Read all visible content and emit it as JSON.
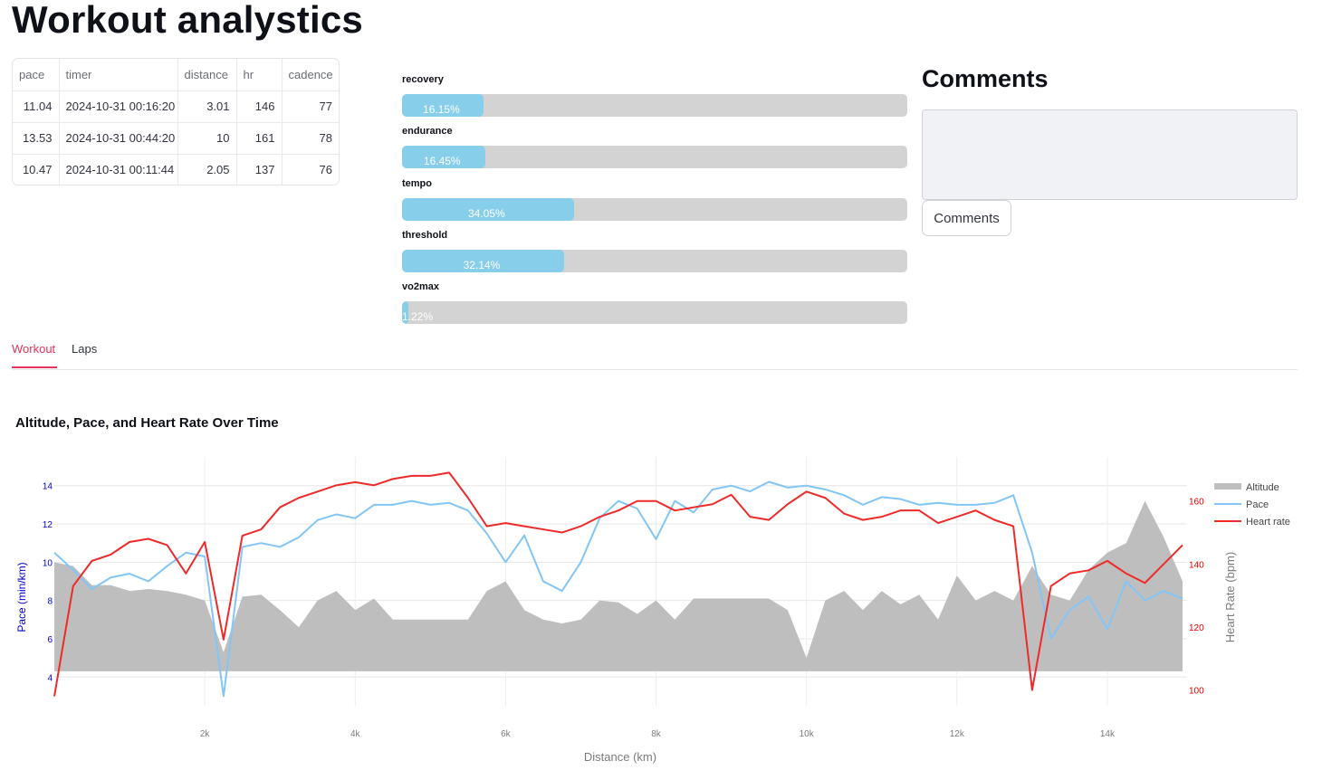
{
  "page": {
    "title": "Workout analystics"
  },
  "summary_table": {
    "columns": [
      "pace",
      "timer",
      "distance",
      "hr",
      "cadence"
    ],
    "rows": [
      [
        "11.04",
        "2024-10-31 00:16:20",
        "3.01",
        "146",
        "77"
      ],
      [
        "13.53",
        "2024-10-31 00:44:20",
        "10",
        "161",
        "78"
      ],
      [
        "10.47",
        "2024-10-31 00:11:44",
        "2.05",
        "137",
        "76"
      ]
    ]
  },
  "zones": [
    {
      "name": "recovery",
      "pct_label": "16.15%",
      "value": 16.15
    },
    {
      "name": "endurance",
      "pct_label": "16.45%",
      "value": 16.45
    },
    {
      "name": "tempo",
      "pct_label": "34.05%",
      "value": 34.05
    },
    {
      "name": "threshold",
      "pct_label": "32.14%",
      "value": 32.14
    },
    {
      "name": "vo2max",
      "pct_label": "1.22%",
      "value": 1.22
    }
  ],
  "comments": {
    "heading": "Comments",
    "textarea_value": "",
    "button_label": "Comments"
  },
  "tabs": {
    "workout": "Workout",
    "laps": "Laps",
    "active": "workout"
  },
  "colors": {
    "accent": "#e5345b",
    "zone_fill": "#87ceeb",
    "zone_track": "#d3d3d3",
    "altitude": "#bebebe",
    "pace": "#82c5f7",
    "heart_rate": "#ee2a2a",
    "pace_axis": "#0000cc",
    "hr_axis": "#dd0000"
  },
  "chart_data": {
    "type": "line",
    "title": "Altitude, Pace, and Heart Rate Over Time",
    "xlabel": "Distance (km)",
    "ylabel_left": "Pace (min/km)",
    "ylabel_right": "Heart Rate (bpm)",
    "x_ticks": [
      "2k",
      "4k",
      "6k",
      "8k",
      "10k",
      "12k",
      "14k"
    ],
    "x_tick_values": [
      2,
      4,
      6,
      8,
      10,
      12,
      14
    ],
    "xlim": [
      0,
      15.06
    ],
    "y_left_ticks": [
      4,
      6,
      8,
      10,
      12,
      14
    ],
    "y_left_lim": [
      2.5,
      15.5
    ],
    "y_right_ticks": [
      100,
      120,
      140,
      160
    ],
    "y_right_lim": [
      95,
      174
    ],
    "legend": [
      "Altitude",
      "Pace",
      "Heart rate"
    ],
    "legend_position": "top-right",
    "grid": true,
    "x": [
      0,
      0.25,
      0.5,
      0.75,
      1,
      1.25,
      1.5,
      1.75,
      2,
      2.25,
      2.5,
      2.75,
      3,
      3.25,
      3.5,
      3.75,
      4,
      4.25,
      4.5,
      4.75,
      5,
      5.25,
      5.5,
      5.75,
      6,
      6.25,
      6.5,
      6.75,
      7,
      7.25,
      7.5,
      7.75,
      8,
      8.25,
      8.5,
      8.75,
      9,
      9.25,
      9.5,
      9.75,
      10,
      10.25,
      10.5,
      10.75,
      11,
      11.25,
      11.5,
      11.75,
      12,
      12.25,
      12.5,
      12.75,
      13,
      13.25,
      13.5,
      13.75,
      14,
      14.25,
      14.5,
      14.75,
      15
    ],
    "series": [
      {
        "name": "Altitude",
        "axis": "left",
        "values": [
          10,
          9.8,
          8.8,
          8.8,
          8.5,
          8.6,
          8.5,
          8.3,
          8.0,
          5.3,
          8.2,
          8.3,
          7.5,
          6.6,
          8.0,
          8.5,
          7.5,
          8.1,
          7.0,
          7.0,
          7.0,
          7.0,
          7.0,
          8.5,
          9.0,
          7.5,
          7.0,
          6.8,
          7.0,
          8.0,
          7.9,
          7.3,
          8.0,
          7.0,
          8.1,
          8.1,
          8.1,
          8.1,
          8.1,
          7.5,
          5.0,
          8.0,
          8.5,
          7.5,
          8.5,
          7.8,
          8.3,
          7.0,
          9.3,
          8.0,
          8.5,
          8.0,
          9.8,
          8.3,
          8.0,
          9.6,
          10.5,
          11.0,
          13.2,
          11.3,
          9.0
        ]
      },
      {
        "name": "Pace",
        "axis": "left",
        "values": [
          10.5,
          9.6,
          8.6,
          9.2,
          9.4,
          9.0,
          9.8,
          10.5,
          10.3,
          3.0,
          10.8,
          11.0,
          10.8,
          11.3,
          12.2,
          12.5,
          12.3,
          13.0,
          13.0,
          13.2,
          13.0,
          13.1,
          12.7,
          11.5,
          10.0,
          11.4,
          9.0,
          8.5,
          10.0,
          12.3,
          13.2,
          12.8,
          11.2,
          13.2,
          12.6,
          13.8,
          14.0,
          13.7,
          14.2,
          13.9,
          14.0,
          13.8,
          13.5,
          13.0,
          13.4,
          13.3,
          13.0,
          13.1,
          13.0,
          13.0,
          13.1,
          13.5,
          10.5,
          6.0,
          7.5,
          8.2,
          6.5,
          9.0,
          8.0,
          8.5,
          8.1
        ]
      },
      {
        "name": "Heart rate",
        "axis": "right",
        "values": [
          98,
          133,
          141,
          143,
          147,
          148,
          146,
          137,
          147,
          116,
          149,
          151,
          158,
          161,
          163,
          165,
          166,
          165,
          167,
          168,
          168,
          169,
          161,
          152,
          153,
          152,
          151,
          150,
          152,
          155,
          157,
          160,
          160,
          157,
          158,
          159,
          162,
          155,
          154,
          159,
          163,
          161,
          156,
          154,
          155,
          157,
          157,
          153,
          155,
          157,
          154,
          152,
          100,
          133,
          137,
          138,
          141,
          137,
          134,
          140,
          146
        ]
      }
    ]
  }
}
